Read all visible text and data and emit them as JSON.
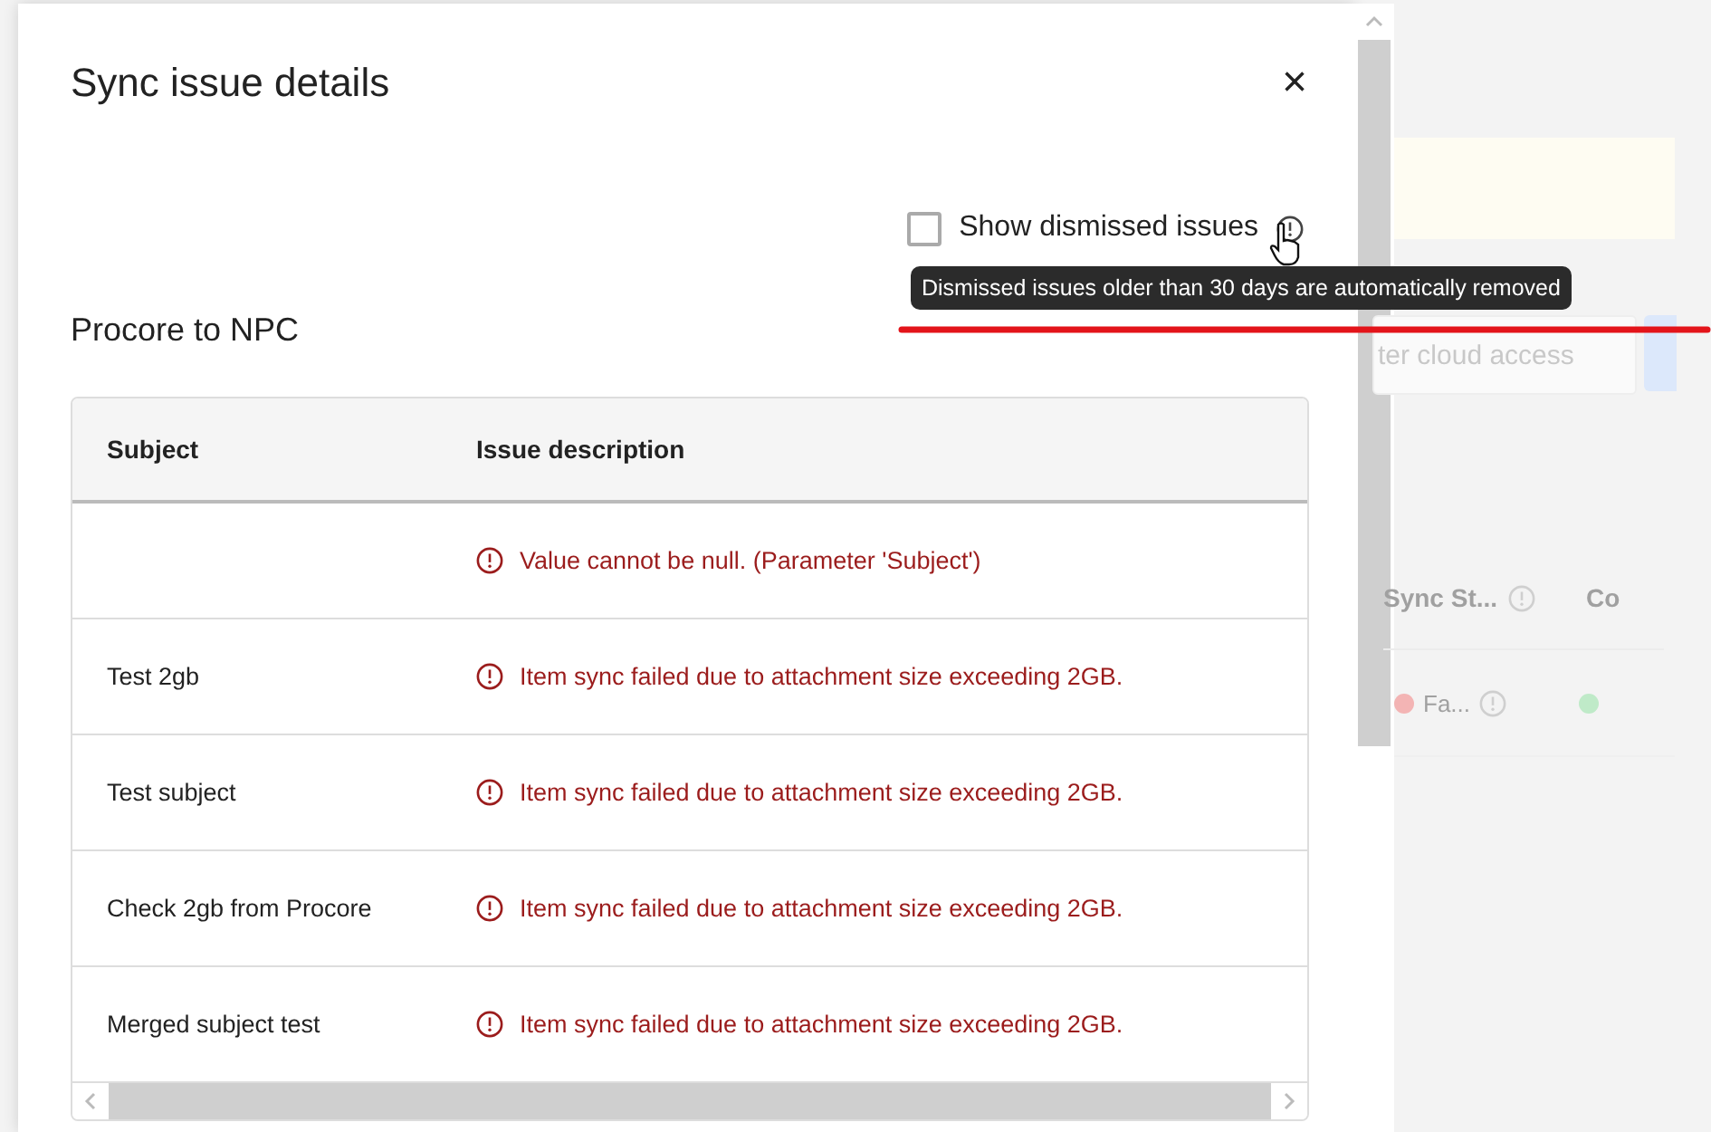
{
  "dialog": {
    "title": "Sync issue details",
    "close": "×",
    "show_dismissed": {
      "label": "Show dismissed issues",
      "checked": false
    },
    "tooltip": "Dismissed issues older than 30 days are automatically removed",
    "section_title": "Procore to NPC",
    "table": {
      "columns": [
        "Subject",
        "Issue description"
      ],
      "rows": [
        {
          "issue": "Value cannot be null. (Parameter 'Subject')"
        },
        {
          "subject": "Test 2gb",
          "issue": "Item sync failed due to attachment size exceeding 2GB."
        },
        {
          "subject": "Test subject",
          "issue": "Item sync failed due to attachment size exceeding 2GB."
        },
        {
          "subject": "Check 2gb from Procore",
          "issue": "Item sync failed due to attachment size exceeding 2GB."
        },
        {
          "subject": "Merged subject test",
          "issue": "Item sync failed due to attachment size exceeding 2GB."
        }
      ]
    }
  },
  "background": {
    "field_placeholder": "ter cloud access",
    "columns": [
      "Sync St...",
      "Co"
    ],
    "row": [
      {
        "text": "Fa...",
        "color": "#f3b4b4"
      },
      {
        "color": "#bfeac8"
      }
    ]
  }
}
